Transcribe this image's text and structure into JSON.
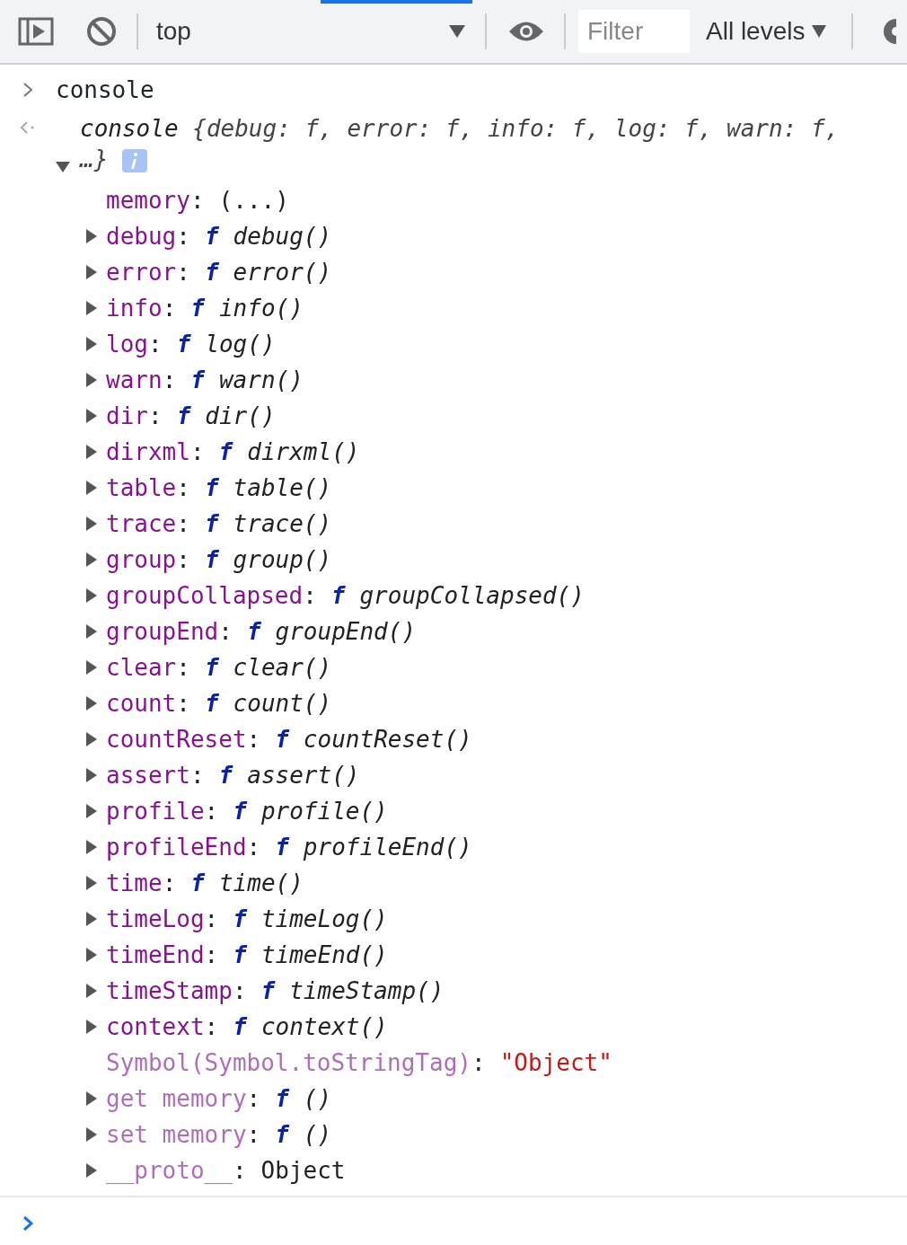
{
  "toolbar": {
    "context": "top",
    "filter": {
      "placeholder": "Filter"
    },
    "levels": "All levels"
  },
  "input": "console",
  "result": {
    "title": "console",
    "preview": "{debug: f, error: f, info: f, log: f, warn: f, …}",
    "expanded": true,
    "properties": [
      {
        "separator": ":",
        "key": "memory",
        "kind": "accessor",
        "value": "(...)",
        "expandable": false,
        "dim": false
      },
      {
        "separator": ":",
        "key": "debug",
        "kind": "function",
        "mark": "f",
        "value": "debug()",
        "expandable": true,
        "dim": false
      },
      {
        "separator": ":",
        "key": "error",
        "kind": "function",
        "mark": "f",
        "value": "error()",
        "expandable": true,
        "dim": false
      },
      {
        "separator": ":",
        "key": "info",
        "kind": "function",
        "mark": "f",
        "value": "info()",
        "expandable": true,
        "dim": false
      },
      {
        "separator": ":",
        "key": "log",
        "kind": "function",
        "mark": "f",
        "value": "log()",
        "expandable": true,
        "dim": false
      },
      {
        "separator": ":",
        "key": "warn",
        "kind": "function",
        "mark": "f",
        "value": "warn()",
        "expandable": true,
        "dim": false
      },
      {
        "separator": ":",
        "key": "dir",
        "kind": "function",
        "mark": "f",
        "value": "dir()",
        "expandable": true,
        "dim": false
      },
      {
        "separator": ":",
        "key": "dirxml",
        "kind": "function",
        "mark": "f",
        "value": "dirxml()",
        "expandable": true,
        "dim": false
      },
      {
        "separator": ":",
        "key": "table",
        "kind": "function",
        "mark": "f",
        "value": "table()",
        "expandable": true,
        "dim": false
      },
      {
        "separator": ":",
        "key": "trace",
        "kind": "function",
        "mark": "f",
        "value": "trace()",
        "expandable": true,
        "dim": false
      },
      {
        "separator": ":",
        "key": "group",
        "kind": "function",
        "mark": "f",
        "value": "group()",
        "expandable": true,
        "dim": false
      },
      {
        "separator": ":",
        "key": "groupCollapsed",
        "kind": "function",
        "mark": "f",
        "value": "groupCollapsed()",
        "expandable": true,
        "dim": false
      },
      {
        "separator": ":",
        "key": "groupEnd",
        "kind": "function",
        "mark": "f",
        "value": "groupEnd()",
        "expandable": true,
        "dim": false
      },
      {
        "separator": ":",
        "key": "clear",
        "kind": "function",
        "mark": "f",
        "value": "clear()",
        "expandable": true,
        "dim": false
      },
      {
        "separator": ":",
        "key": "count",
        "kind": "function",
        "mark": "f",
        "value": "count()",
        "expandable": true,
        "dim": false
      },
      {
        "separator": ":",
        "key": "countReset",
        "kind": "function",
        "mark": "f",
        "value": "countReset()",
        "expandable": true,
        "dim": false
      },
      {
        "separator": ":",
        "key": "assert",
        "kind": "function",
        "mark": "f",
        "value": "assert()",
        "expandable": true,
        "dim": false
      },
      {
        "separator": ":",
        "key": "profile",
        "kind": "function",
        "mark": "f",
        "value": "profile()",
        "expandable": true,
        "dim": false
      },
      {
        "separator": ":",
        "key": "profileEnd",
        "kind": "function",
        "mark": "f",
        "value": "profileEnd()",
        "expandable": true,
        "dim": false
      },
      {
        "separator": ":",
        "key": "time",
        "kind": "function",
        "mark": "f",
        "value": "time()",
        "expandable": true,
        "dim": false
      },
      {
        "separator": ":",
        "key": "timeLog",
        "kind": "function",
        "mark": "f",
        "value": "timeLog()",
        "expandable": true,
        "dim": false
      },
      {
        "separator": ":",
        "key": "timeEnd",
        "kind": "function",
        "mark": "f",
        "value": "timeEnd()",
        "expandable": true,
        "dim": false
      },
      {
        "separator": ":",
        "key": "timeStamp",
        "kind": "function",
        "mark": "f",
        "value": "timeStamp()",
        "expandable": true,
        "dim": false
      },
      {
        "separator": ":",
        "key": "context",
        "kind": "function",
        "mark": "f",
        "value": "context()",
        "expandable": true,
        "dim": false
      },
      {
        "separator": ":",
        "key": "Symbol(Symbol.toStringTag)",
        "kind": "string",
        "value": "\"Object\"",
        "expandable": false,
        "dim": true
      },
      {
        "separator": ":",
        "key": "get memory",
        "kind": "function",
        "mark": "f",
        "value": "()",
        "expandable": true,
        "dim": true
      },
      {
        "separator": ":",
        "key": "set memory",
        "kind": "function",
        "mark": "f",
        "value": "()",
        "expandable": true,
        "dim": true
      },
      {
        "separator": ":",
        "key": "__proto__",
        "kind": "object",
        "value": "Object",
        "expandable": true,
        "dim": true
      }
    ]
  }
}
